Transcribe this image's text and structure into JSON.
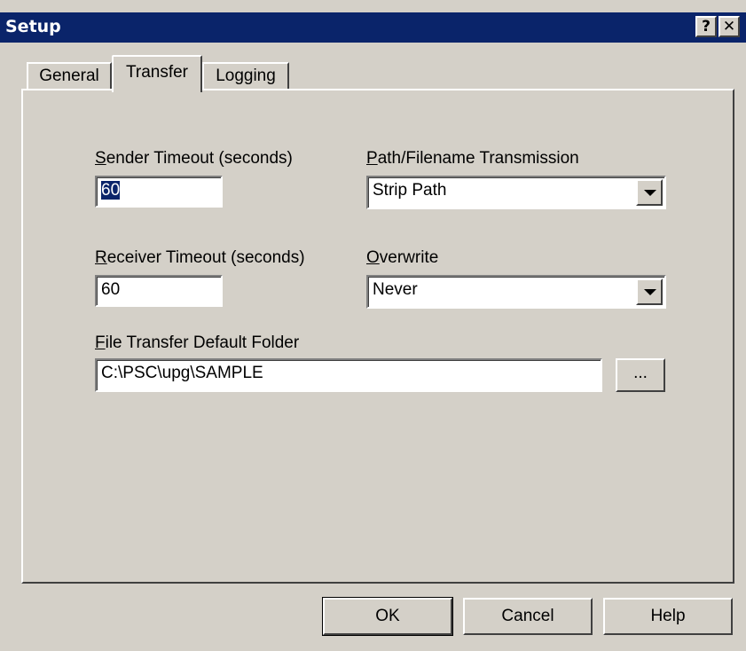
{
  "window": {
    "title": "Setup",
    "help_glyph": "?",
    "close_glyph": "✕"
  },
  "tabs": [
    {
      "label": "General"
    },
    {
      "label": "Transfer"
    },
    {
      "label": "Logging"
    }
  ],
  "active_tab": "Transfer",
  "transfer": {
    "sender_timeout": {
      "mnemonic": "S",
      "label_rest": "ender Timeout (seconds)",
      "value": "60"
    },
    "receiver_timeout": {
      "mnemonic": "R",
      "label_rest": "eceiver Timeout (seconds)",
      "value": "60"
    },
    "path_transmission": {
      "mnemonic": "P",
      "label_rest": "ath/Filename Transmission",
      "selected": "Strip Path"
    },
    "overwrite": {
      "mnemonic": "O",
      "label_rest": "verwrite",
      "selected": "Never"
    },
    "default_folder": {
      "mnemonic": "F",
      "label_rest": "ile Transfer Default Folder",
      "value": "C:\\PSC\\upg\\SAMPLE",
      "browse_label": "..."
    }
  },
  "buttons": {
    "ok": "OK",
    "cancel": "Cancel",
    "help": "Help"
  }
}
